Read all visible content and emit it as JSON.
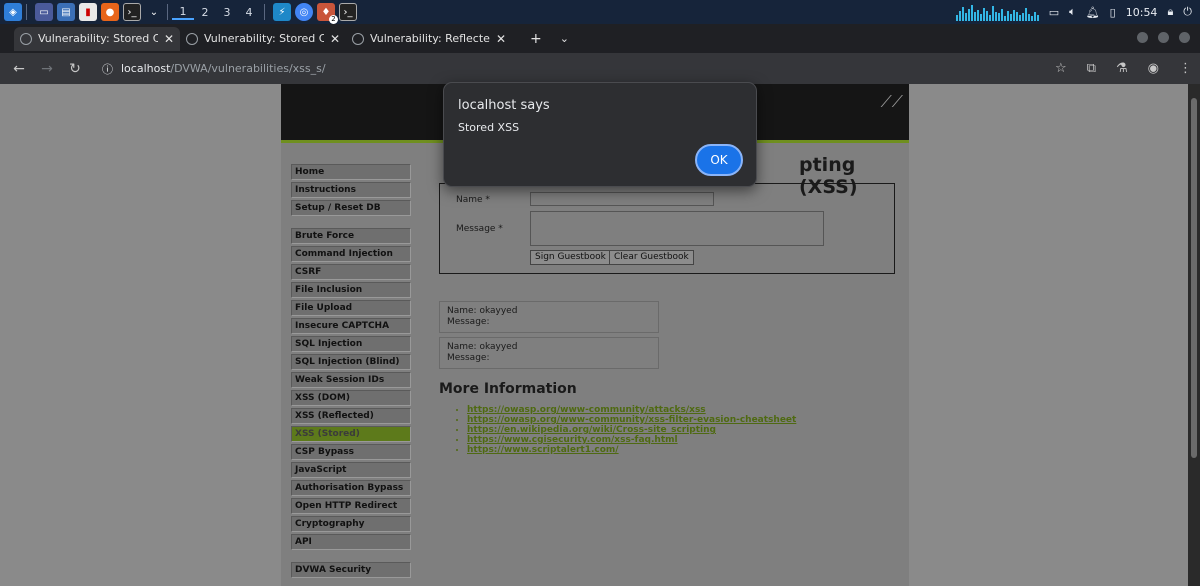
{
  "taskbar": {
    "workspaces": [
      "1",
      "2",
      "3",
      "4"
    ],
    "clock": "10:54",
    "icons": [
      "start-menu-icon",
      "desktop-icon",
      "file-manager-icon",
      "document-icon",
      "firefox-icon",
      "terminal-icon",
      "burp-icon",
      "chrome-icon",
      "app-badge-icon",
      "terminal-small-icon"
    ],
    "badge_count": "2"
  },
  "browser": {
    "tabs": [
      {
        "title": "Vulnerability: Stored Cro",
        "active": true
      },
      {
        "title": "Vulnerability: Stored Cro",
        "active": false
      },
      {
        "title": "Vulnerability: Reflected C",
        "active": false
      }
    ],
    "url_host": "localhost",
    "url_path": "/DVWA/vulnerabilities/xss_s/"
  },
  "dvwa": {
    "menu_groups": [
      [
        "Home",
        "Instructions",
        "Setup / Reset DB"
      ],
      [
        "Brute Force",
        "Command Injection",
        "CSRF",
        "File Inclusion",
        "File Upload",
        "Insecure CAPTCHA",
        "SQL Injection",
        "SQL Injection (Blind)",
        "Weak Session IDs",
        "XSS (DOM)",
        "XSS (Reflected)",
        "XSS (Stored)",
        "CSP Bypass",
        "JavaScript",
        "Authorisation Bypass",
        "Open HTTP Redirect",
        "Cryptography",
        "API"
      ],
      [
        "DVWA Security"
      ]
    ],
    "selected_menu": "XSS (Stored)",
    "page_title_visible": "pting (XSS)",
    "form": {
      "name_label": "Name *",
      "message_label": "Message *",
      "name_value": "",
      "message_value": "",
      "sign_button": "Sign Guestbook",
      "clear_button": "Clear Guestbook"
    },
    "guestbook": [
      {
        "name": "Name: okayyed",
        "message": "Message:"
      },
      {
        "name": "Name: okayyed",
        "message": "Message:"
      }
    ],
    "more_info_title": "More Information",
    "links": [
      "https://owasp.org/www-community/attacks/xss",
      "https://owasp.org/www-community/xss-filter-evasion-cheatsheet",
      "https://en.wikipedia.org/wiki/Cross-site_scripting",
      "https://www.cgisecurity.com/xss-faq.html",
      "https://www.scriptalert1.com/"
    ]
  },
  "dialog": {
    "title": "localhost says",
    "message": "Stored XSS",
    "ok_label": "OK"
  },
  "colors": {
    "accent": "#1a73e8",
    "dvwa_green": "#5d7a1b",
    "link_green": "#4f6a12"
  }
}
